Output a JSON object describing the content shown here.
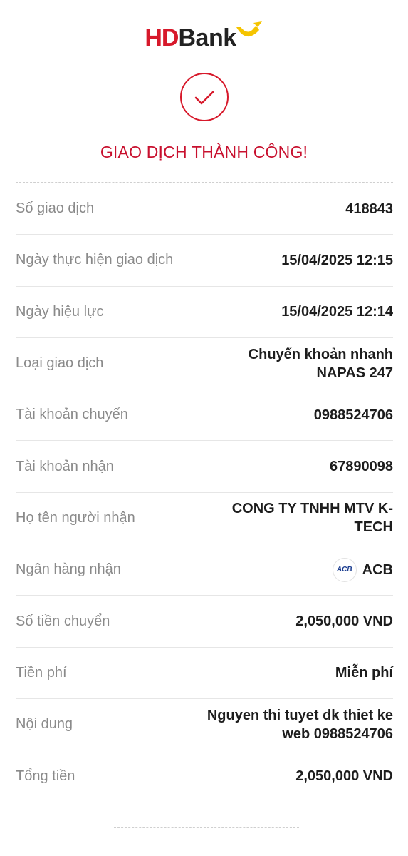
{
  "logo": {
    "brand_hd": "HD",
    "brand_bank": "Bank"
  },
  "status": {
    "title": "GIAO DỊCH THÀNH CÔNG!",
    "icon": "check-circle-icon"
  },
  "colors": {
    "brand_red": "#d7192b",
    "brand_yellow": "#f5c400",
    "status_red": "#c8102e"
  },
  "details": [
    {
      "label": "Số giao dịch",
      "value": "418843"
    },
    {
      "label": "Ngày thực hiện giao dịch",
      "value": "15/04/2025 12:15"
    },
    {
      "label": "Ngày hiệu lực",
      "value": "15/04/2025 12:14"
    },
    {
      "label": "Loại giao dịch",
      "value": "Chuyển khoản nhanh NAPAS 247"
    },
    {
      "label": "Tài khoản chuyển",
      "value": "0988524706"
    },
    {
      "label": "Tài khoản nhận",
      "value": "67890098"
    },
    {
      "label": "Họ tên người nhận",
      "value": "CONG TY TNHH MTV K-TECH"
    },
    {
      "label": "Ngân hàng nhận",
      "value": "ACB",
      "logo_text": "ACB"
    },
    {
      "label": "Số tiền chuyển",
      "value": "2,050,000 VND"
    },
    {
      "label": "Tiền phí",
      "value": "Miễn phí"
    },
    {
      "label": "Nội dung",
      "value": "Nguyen thi tuyet dk thiet ke web 0988524706"
    },
    {
      "label": "Tổng tiền",
      "value": "2,050,000 VND"
    }
  ]
}
